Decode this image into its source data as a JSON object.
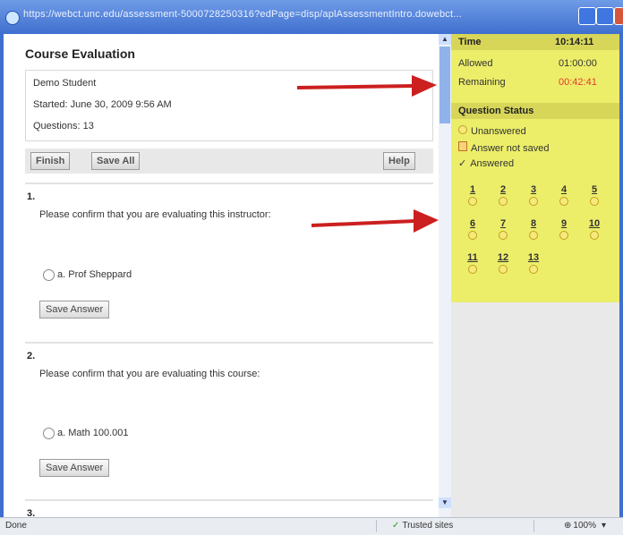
{
  "window": {
    "url": "https://webct.unc.edu/assessment-5000728250316?edPage=disp/aplAssessmentIntro.dowebct..."
  },
  "main": {
    "title": "Course Evaluation",
    "info": {
      "student": "Demo Student",
      "started": "Started: June 30, 2009 9:56 AM",
      "questions": "Questions: 13"
    },
    "toolbar": {
      "finish": "Finish",
      "save_all": "Save All",
      "help": "Help"
    },
    "questions": [
      {
        "number": "1.",
        "text": "Please confirm that you are evaluating this instructor:",
        "option": "a.   Prof Sheppard",
        "save": "Save Answer"
      },
      {
        "number": "2.",
        "text": "Please confirm that you are evaluating this course:",
        "option": "a.   Math 100.001",
        "save": "Save Answer"
      },
      {
        "number": "3."
      }
    ]
  },
  "sidebar": {
    "time_label": "Time",
    "time_value": "10:14:11",
    "allowed_label": "Allowed",
    "allowed_value": "01:00:00",
    "remaining_label": "Remaining",
    "remaining_value": "00:42:41",
    "status_title": "Question Status",
    "legend": {
      "unanswered": "Unanswered",
      "not_saved": "Answer not saved",
      "answered": "Answered"
    },
    "question_numbers": [
      "1",
      "2",
      "3",
      "4",
      "5",
      "6",
      "7",
      "8",
      "9",
      "10",
      "11",
      "12",
      "13"
    ]
  },
  "statusbar": {
    "done": "Done",
    "trusted": "Trusted sites",
    "zoom": "100%"
  },
  "colors": {
    "highlight_yellow": "#ecee6a",
    "remaining_red": "#e33b2b",
    "arrow_red": "#cc1f1f"
  }
}
